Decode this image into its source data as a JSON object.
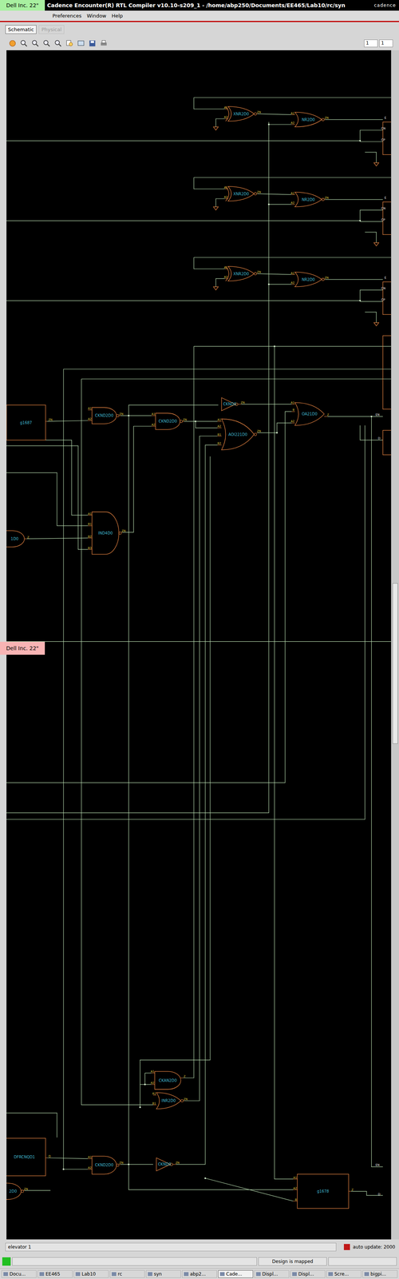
{
  "window": {
    "title": "Cadence Encounter(R) RTL Compiler v10.10-s209_1 - /home/abp250/Documents/EE465/Lab10/rc/syn",
    "logo": "cadence"
  },
  "monitor_badges": [
    {
      "label": "Dell Inc. 22\"",
      "color": "#a8f0a0"
    },
    {
      "label": "Dell Inc. 22\"",
      "color": "#f8b4b4"
    }
  ],
  "menu": [
    "Preferences",
    "Window",
    "Help"
  ],
  "tabs": [
    {
      "label": "Schematic",
      "selected": true,
      "disabled": false
    },
    {
      "label": "Physical",
      "selected": false,
      "disabled": true
    }
  ],
  "page_fields": [
    "1",
    "1"
  ],
  "schematic": {
    "gates": [
      {
        "label": "XNR2D0",
        "kind": "xnor",
        "pins": [
          "A1",
          "A2",
          "ZN"
        ]
      },
      {
        "label": "NR2D0",
        "kind": "nor",
        "pins": [
          "A1",
          "A2",
          "ZN"
        ]
      },
      {
        "label": "XNR2D0",
        "kind": "xnor",
        "pins": [
          "A1",
          "A2",
          "ZN"
        ]
      },
      {
        "label": "NR2D0",
        "kind": "nor",
        "pins": [
          "A1",
          "A2",
          "ZN"
        ]
      },
      {
        "label": "XNR2D0",
        "kind": "xnor",
        "pins": [
          "A1",
          "A2",
          "ZN"
        ]
      },
      {
        "label": "NR2D0",
        "kind": "nor",
        "pins": [
          "A1",
          "A2",
          "ZN"
        ]
      },
      {
        "label": "g1687",
        "kind": "box",
        "pins": [
          "ZN"
        ]
      },
      {
        "label": "CKND2D0",
        "kind": "nand",
        "pins": [
          "A1",
          "A2",
          "ZN"
        ]
      },
      {
        "label": "CKND2D0",
        "kind": "nand",
        "pins": [
          "A1",
          "A2",
          "ZN"
        ]
      },
      {
        "label": "CKND0",
        "kind": "inv",
        "pins": [
          "ZN"
        ]
      },
      {
        "label": "OA21D0",
        "kind": "or",
        "pins": [
          "A1",
          "B",
          "A2",
          "Z"
        ]
      },
      {
        "label": "AOI221D0",
        "kind": "aoi",
        "pins": [
          "A1",
          "A2",
          "B1",
          "B2",
          "ZN"
        ]
      },
      {
        "label": "IND4D0",
        "kind": "nand",
        "pins": [
          "A1",
          "B1",
          "B2",
          "B3",
          "ZN"
        ]
      },
      {
        "label": "1D0",
        "kind": "and",
        "pins": [
          "Z"
        ]
      },
      {
        "label": "CKAN2D0",
        "kind": "and",
        "pins": [
          "A1",
          "A2",
          "Z"
        ]
      },
      {
        "label": "INR2D0",
        "kind": "nor",
        "pins": [
          "A1",
          "B1",
          "ZN"
        ]
      },
      {
        "label": "DFRCNQD1",
        "kind": "box",
        "pins": [
          "Q"
        ]
      },
      {
        "label": "2D0",
        "kind": "nand",
        "pins": [
          "ZN"
        ]
      },
      {
        "label": "CKND2D0",
        "kind": "nand",
        "pins": [
          "A1",
          "A2",
          "ZN"
        ]
      },
      {
        "label": "CKND0",
        "kind": "inv",
        "pins": [
          "ZN"
        ]
      },
      {
        "label": "g1678",
        "kind": "box",
        "pins": [
          "A1",
          "A2",
          "B",
          "Z"
        ]
      }
    ],
    "port_labels": [
      "E",
      "CN",
      "CP",
      "E",
      "CN",
      "CP",
      "E",
      "CN",
      "CP",
      "EN",
      "D",
      "EN",
      "D"
    ]
  },
  "status_bar": {
    "left": "elevator 1",
    "right": "auto update: 2000",
    "message": "Design is mapped"
  },
  "taskbar": [
    {
      "label": "Docu...",
      "selected": false
    },
    {
      "label": "EE465",
      "selected": false
    },
    {
      "label": "Lab10",
      "selected": false
    },
    {
      "label": "rc",
      "selected": false
    },
    {
      "label": "syn",
      "selected": false
    },
    {
      "label": "abp2...",
      "selected": false
    },
    {
      "label": "Cade...",
      "selected": true
    },
    {
      "label": "Displ...",
      "selected": false
    },
    {
      "label": "Displ...",
      "selected": false
    },
    {
      "label": "Scre...",
      "selected": false
    },
    {
      "label": "bigpi...",
      "selected": false
    }
  ]
}
